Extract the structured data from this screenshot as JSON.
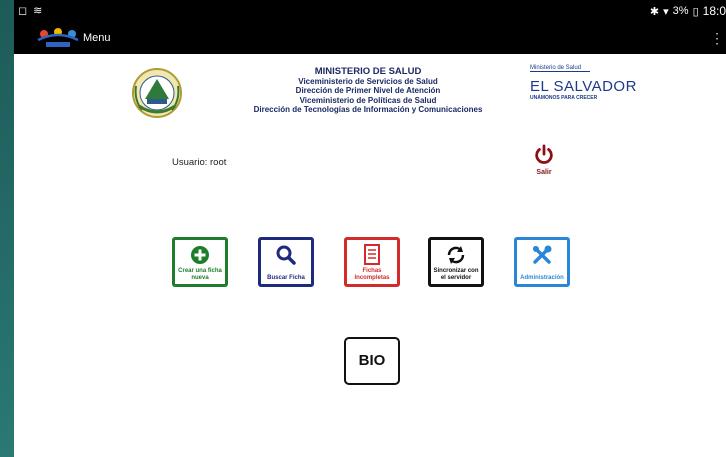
{
  "status_bar": {
    "right_text": "3%",
    "time": "18:0"
  },
  "app_bar": {
    "title": "Menu"
  },
  "header": {
    "lines": [
      "MINISTERIO DE SALUD",
      "Viceministerio  de Servicios de Salud",
      "Dirección de Primer Nivel de Atención",
      "Viceministerio de  Políticas de Salud",
      "Dirección de Tecnologías de Información y Comunicaciones"
    ],
    "brand_small": "Ministerio de Salud",
    "brand_big": "EL SALVADOR",
    "brand_tag": "UNÁMONOS PARA CRECER"
  },
  "user": {
    "label": "Usuario: root"
  },
  "logout": {
    "label": "Salir",
    "color": "#8b1016"
  },
  "tiles": [
    {
      "label": "Crear una ficha nueva",
      "color": "#1e7d2a"
    },
    {
      "label": "Buscar Ficha",
      "color": "#1e2a7d"
    },
    {
      "label": "Fichas Incompletas",
      "color": "#d32b2b"
    },
    {
      "label": "Sincronizar con el servidor",
      "color": "#111111"
    },
    {
      "label": "Administración",
      "color": "#2a86d8"
    }
  ],
  "bio": {
    "label": "BIO"
  }
}
